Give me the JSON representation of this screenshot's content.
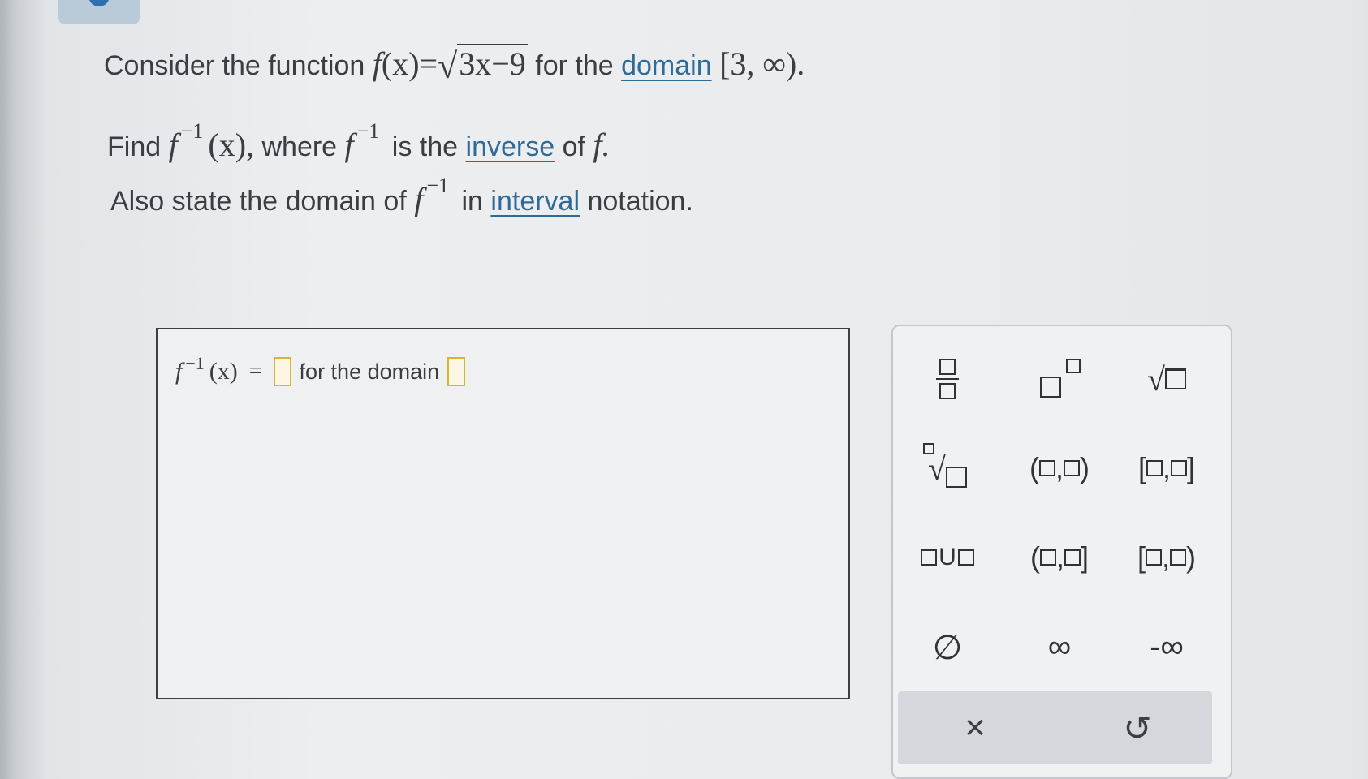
{
  "question": {
    "line1_prefix": "Consider the function",
    "line1_f": "f",
    "line1_x": "(x)",
    "line1_eq": "=",
    "line1_radicand": "3x−9",
    "line1_mid": "for the",
    "line1_link": "domain",
    "line1_interval": "[3, ∞).",
    "line2_prefix": "Find",
    "line2_f": "f",
    "line2_exp": "−1",
    "line2_x": "(x),",
    "line2_mid": "where",
    "line2_f2": "f",
    "line2_exp2": "−1",
    "line2_mid2": "is the",
    "line2_link": "inverse",
    "line2_suffix": "of",
    "line2_f3": "f.",
    "line3_prefix": "Also state the domain of",
    "line3_f": "f",
    "line3_exp": "−1",
    "line3_mid": "in",
    "line3_link": "interval",
    "line3_suffix": "notation."
  },
  "answer": {
    "f": "f",
    "exp": "−1",
    "x": "(x)",
    "eq": "=",
    "label": "for the domain"
  },
  "palette": {
    "infinity": "∞",
    "neg_infinity": "-∞",
    "empty_set": "∅",
    "union": "U",
    "open_open_l": "(",
    "open_open_r": ")",
    "closed_closed_l": "[",
    "closed_closed_r": "]",
    "comma": ",",
    "close_label": "×",
    "reset_label": "↺"
  },
  "colors": {
    "link": "#2f6b97",
    "slot_border": "#d6b62d",
    "text": "#3a3d42"
  }
}
